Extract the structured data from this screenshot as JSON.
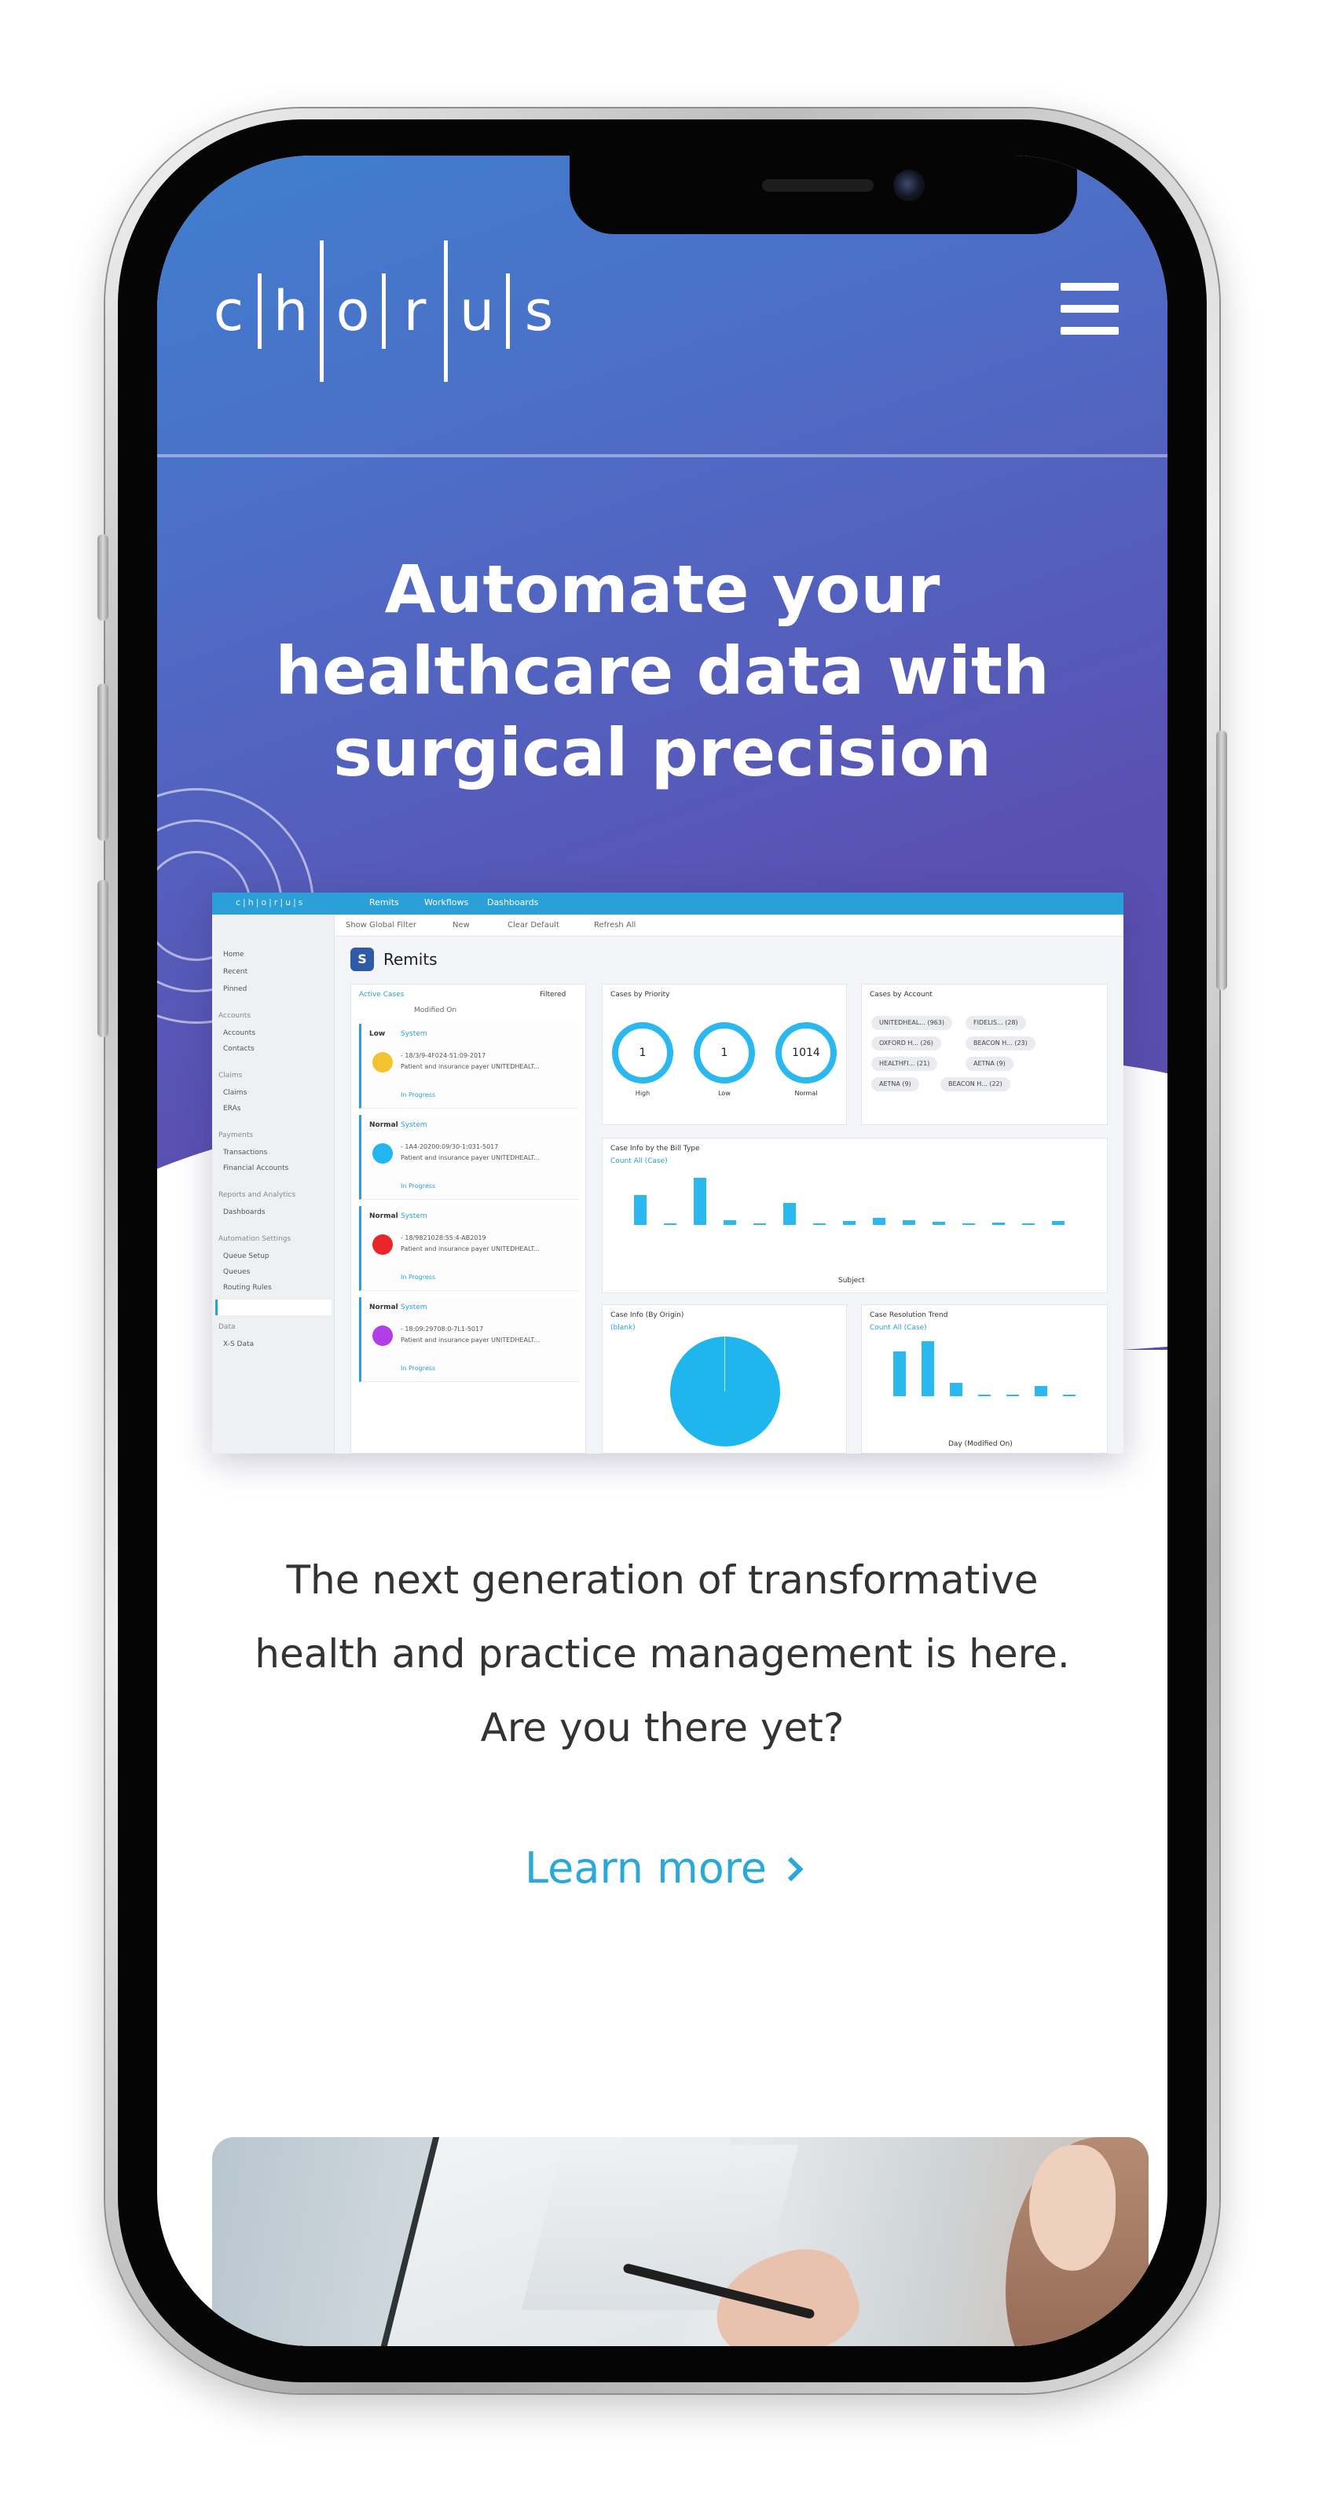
{
  "header": {
    "logo_letters": [
      "c",
      "h",
      "o",
      "r",
      "u",
      "s"
    ],
    "menu_icon": "hamburger-menu-icon"
  },
  "hero": {
    "title": "Automate your\nhealthcare data with\nsurgical precision"
  },
  "dashboard": {
    "logo": "c|h|o|r|u|s",
    "nav": [
      "Remits",
      "Workflows",
      "Dashboards"
    ],
    "command_bar": [
      "Show Global Filter",
      "New",
      "Clear Default",
      "Refresh All"
    ],
    "app_title": "Remits",
    "app_badge": "S",
    "sidebar": {
      "items_top": [
        "Home",
        "Recent",
        "Pinned"
      ],
      "sections": [
        {
          "heading": "Accounts",
          "items": [
            "Accounts",
            "Contacts"
          ]
        },
        {
          "heading": "Claims",
          "items": [
            "Claims",
            "ERAs"
          ]
        },
        {
          "heading": "Payments",
          "items": [
            "Transactions",
            "Financial Accounts"
          ]
        },
        {
          "heading": "Reports and Analytics",
          "items": [
            "Dashboards"
          ]
        },
        {
          "heading": "Automation Settings",
          "items": [
            "Queue Setup",
            "Queues",
            "Routing Rules"
          ]
        },
        {
          "heading": "Data",
          "items": [
            "X-S Data"
          ]
        }
      ]
    },
    "cases_panel": {
      "title": "Active Cases",
      "filter": "Filtered",
      "sort": "Modified On",
      "cards": [
        {
          "priority": "Low",
          "source": "System",
          "line1": "- 18/3/9-4F024-51:09-2017",
          "line2": "Patient and insurance payer UNITEDHEALT...",
          "progress": "In Progress",
          "color": "#f2c230"
        },
        {
          "priority": "Normal",
          "source": "System",
          "line1": "- 1A4-20200:09/30-1:031-5017",
          "line2": "Patient and insurance payer UNITEDHEALT...",
          "progress": "In Progress",
          "color": "#22b5ef"
        },
        {
          "priority": "Normal",
          "source": "System",
          "line1": "- 18/9821028:55:4-AB2019",
          "line2": "Patient and insurance payer UNITEDHEALT...",
          "progress": "In Progress",
          "color": "#e8262b"
        },
        {
          "priority": "Normal",
          "source": "System",
          "line1": "- 18:09:29708:0-7L1-5017",
          "line2": "Patient and insurance payer UNITEDHEALT...",
          "progress": "In Progress",
          "color": "#b23ee6"
        }
      ]
    },
    "priority_panel": {
      "title": "Cases by Priority",
      "donuts": [
        {
          "value": "1",
          "label": "High"
        },
        {
          "value": "1",
          "label": "Low"
        },
        {
          "value": "1014",
          "label": "Normal"
        }
      ]
    },
    "account_panel": {
      "title": "Cases by Account",
      "chips": [
        "UNITEDHEAL... (963)",
        "FIDELIS... (28)",
        "OXFORD H... (26)",
        "BEACON H... (23)",
        "HEALTHFI... (21)",
        "AETNA (9)",
        "AETNA (9)",
        "BEACON H... (22)"
      ]
    },
    "bill_panel": {
      "title": "Case Info by the Bill Type",
      "legend": "Count All (Case)",
      "bar_values": [
        300,
        2,
        471,
        44,
        2,
        218,
        7,
        40,
        70,
        45,
        34,
        1,
        22,
        8,
        40
      ],
      "xlabel": "Subject"
    },
    "pie_panel": {
      "title": "Case Info (By Origin)",
      "legend": "(blank)"
    },
    "trend_panel": {
      "title": "Case Resolution Trend",
      "legend": "Count All (Case)",
      "bar_values": [
        814,
        1000,
        242,
        26,
        5,
        190,
        1
      ],
      "xlabel": "Day (Modified On)"
    }
  },
  "content": {
    "tagline": "The next generation of transformative\nhealth and practice management is here.\nAre you there yet?",
    "learn_more": "Learn more"
  }
}
